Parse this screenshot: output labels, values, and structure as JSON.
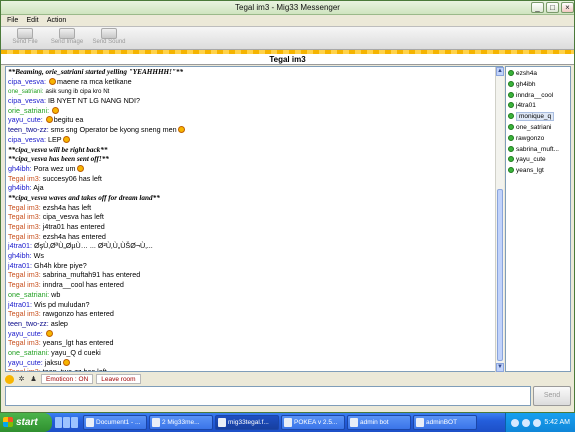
{
  "window": {
    "title": "Tegal im3 - Mig33 Messenger",
    "controls": [
      "_",
      "□",
      "×"
    ]
  },
  "menu": [
    "File",
    "Edit",
    "Action"
  ],
  "toolbar": [
    {
      "label": "Send File",
      "icon": "send-file-icon"
    },
    {
      "label": "Send Image",
      "icon": "send-image-icon"
    },
    {
      "label": "Send Sound",
      "icon": "send-sound-icon"
    }
  ],
  "room_title": "Tegal im3",
  "colors": {
    "system": "#c8501e",
    "blue": "#1a1acc",
    "green": "#22a022",
    "darkblue": "#0a0a8a",
    "action": "#000000"
  },
  "messages": [
    {
      "text": "**Beaming, orie_satriani started yelling \"YEAHHHH!\"**",
      "type": "action"
    },
    {
      "name": "cipa_vesva:",
      "text": "maene ra mca ketikane",
      "color": "blue",
      "emoticon": true,
      "emo_pos": "before"
    },
    {
      "name": "one_satriani:",
      "text": "asik sung ib cipa kro Nt",
      "color": "green",
      "small": true
    },
    {
      "name": "cipa_vesva:",
      "text": "IB NYET NT LG NANG NDI?",
      "color": "blue"
    },
    {
      "name": "orie_satriani:",
      "text": "",
      "color": "green",
      "emoticon": true,
      "emo_pos": "after"
    },
    {
      "name": "yayu_cute:",
      "text": "begitu ea",
      "color": "blue",
      "emoticon": true,
      "emo_pos": "before"
    },
    {
      "name": "teen_two-zz:",
      "text": "sms sng Operator be kyong sneng men",
      "color": "darkblue",
      "emoticon": true,
      "emo_pos": "after"
    },
    {
      "name": "cipa_vesva:",
      "text": "LEP",
      "color": "blue",
      "emoticon": true,
      "emo_pos": "after"
    },
    {
      "text": "**cipa_vesva will be right back**",
      "type": "action"
    },
    {
      "text": "**cipa_vesva has been sent off!**",
      "type": "action"
    },
    {
      "name": "gh4ibh:",
      "text": "Pora wez um",
      "color": "blue",
      "emoticon": true,
      "emo_pos": "after"
    },
    {
      "name": "Tegal im3:",
      "text": "succesy06 has left",
      "color": "system"
    },
    {
      "name": "gh4ibh:",
      "text": "Aja",
      "color": "blue"
    },
    {
      "text": "**cipa_vesva waves and takes off for dream land**",
      "type": "action"
    },
    {
      "name": "Tegal im3:",
      "text": "ezsh4a has left",
      "color": "system"
    },
    {
      "name": "Tegal im3:",
      "text": "cipa_vesva has left",
      "color": "system"
    },
    {
      "name": "Tegal im3:",
      "text": "j4tra01 has entered",
      "color": "system"
    },
    {
      "name": "Tegal im3:",
      "text": "ezsh4a has entered",
      "color": "system"
    },
    {
      "name": "j4tra01:",
      "text": "ØşÙ‚ØªÙ„ØµÙ… ... Ø²Ù‚Ù„ÙŠØ¬Ù‚...",
      "color": "blue"
    },
    {
      "name": "gh4ibh:",
      "text": "Ws",
      "color": "blue"
    },
    {
      "name": "j4tra01:",
      "text": "Gh4h kbre piye?",
      "color": "blue"
    },
    {
      "name": "Tegal im3:",
      "text": "sabrina_muftah91 has entered",
      "color": "system"
    },
    {
      "name": "Tegal im3:",
      "text": "inndra__cool has entered",
      "color": "system"
    },
    {
      "name": "one_satriani:",
      "text": "wb",
      "color": "green"
    },
    {
      "name": "j4tra01:",
      "text": "Wis pd muludan?",
      "color": "blue"
    },
    {
      "name": "Tegal im3:",
      "text": "rawgonzo has entered",
      "color": "system"
    },
    {
      "name": "teen_two-zz:",
      "text": "aslep",
      "color": "darkblue"
    },
    {
      "name": "yayu_cute:",
      "text": "",
      "color": "blue",
      "emoticon": true,
      "emo_pos": "after"
    },
    {
      "name": "Tegal im3:",
      "text": "yeans_lgt has entered",
      "color": "system"
    },
    {
      "name": "one_satriani:",
      "text": "yayu_Q d cueki",
      "color": "green"
    },
    {
      "name": "yayu_cute:",
      "text": "jaksu",
      "color": "blue",
      "emoticon": true,
      "emo_pos": "after"
    },
    {
      "name": "Tegal im3:",
      "text": "teen_two-zz has left",
      "color": "system"
    }
  ],
  "users": [
    {
      "name": "ezsh4a"
    },
    {
      "name": "gh4ibh"
    },
    {
      "name": "inndra__cool"
    },
    {
      "name": "j4tra01"
    },
    {
      "name": "monique_q",
      "selected": true
    },
    {
      "name": "one_satriani"
    },
    {
      "name": "rawgonzo"
    },
    {
      "name": "sabrina_muft..."
    },
    {
      "name": "yayu_cute"
    },
    {
      "name": "yeans_lgt"
    }
  ],
  "bottom": {
    "emoticon_label": "Emoticon : ON",
    "leave_label": "Leave room"
  },
  "input": {
    "value": "",
    "placeholder": ""
  },
  "send_label": "Send",
  "taskbar": {
    "start": "start",
    "items": [
      {
        "label": "Document1 - ..."
      },
      {
        "label": "2 Mig33me..."
      },
      {
        "label": "mig33tegal.f...",
        "active": true
      },
      {
        "label": "POKEA v 2.5..."
      },
      {
        "label": "admin bot"
      },
      {
        "label": "adminBOT"
      }
    ],
    "clock": "5:42 AM"
  }
}
